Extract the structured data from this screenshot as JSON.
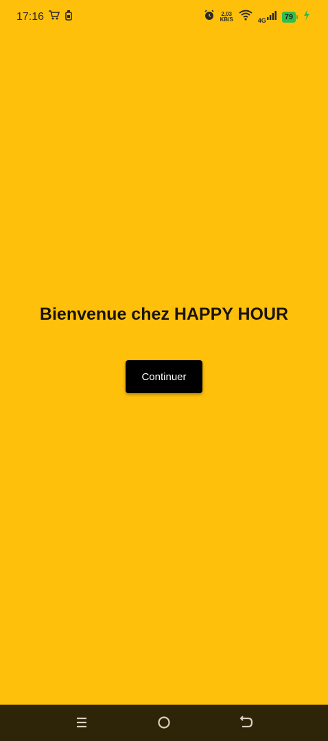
{
  "status_bar": {
    "time": "17:16",
    "net_speed_value": "2,03",
    "net_speed_unit": "KB/S",
    "network_type": "4G",
    "battery_level": "79",
    "icons": [
      "cart-icon",
      "bottle-icon",
      "alarm-icon",
      "wifi-icon",
      "signal-icon",
      "battery-icon",
      "charging-icon"
    ]
  },
  "main": {
    "title": "Bienvenue chez HAPPY HOUR",
    "continue_label": "Continuer"
  },
  "nav_bar": {
    "icons": [
      "menu-icon",
      "home-icon",
      "back-icon"
    ]
  },
  "colors": {
    "background": "#FFC00B",
    "button": "#000000",
    "nav_bar": "#2E2407",
    "battery": "#2EBE4E"
  }
}
